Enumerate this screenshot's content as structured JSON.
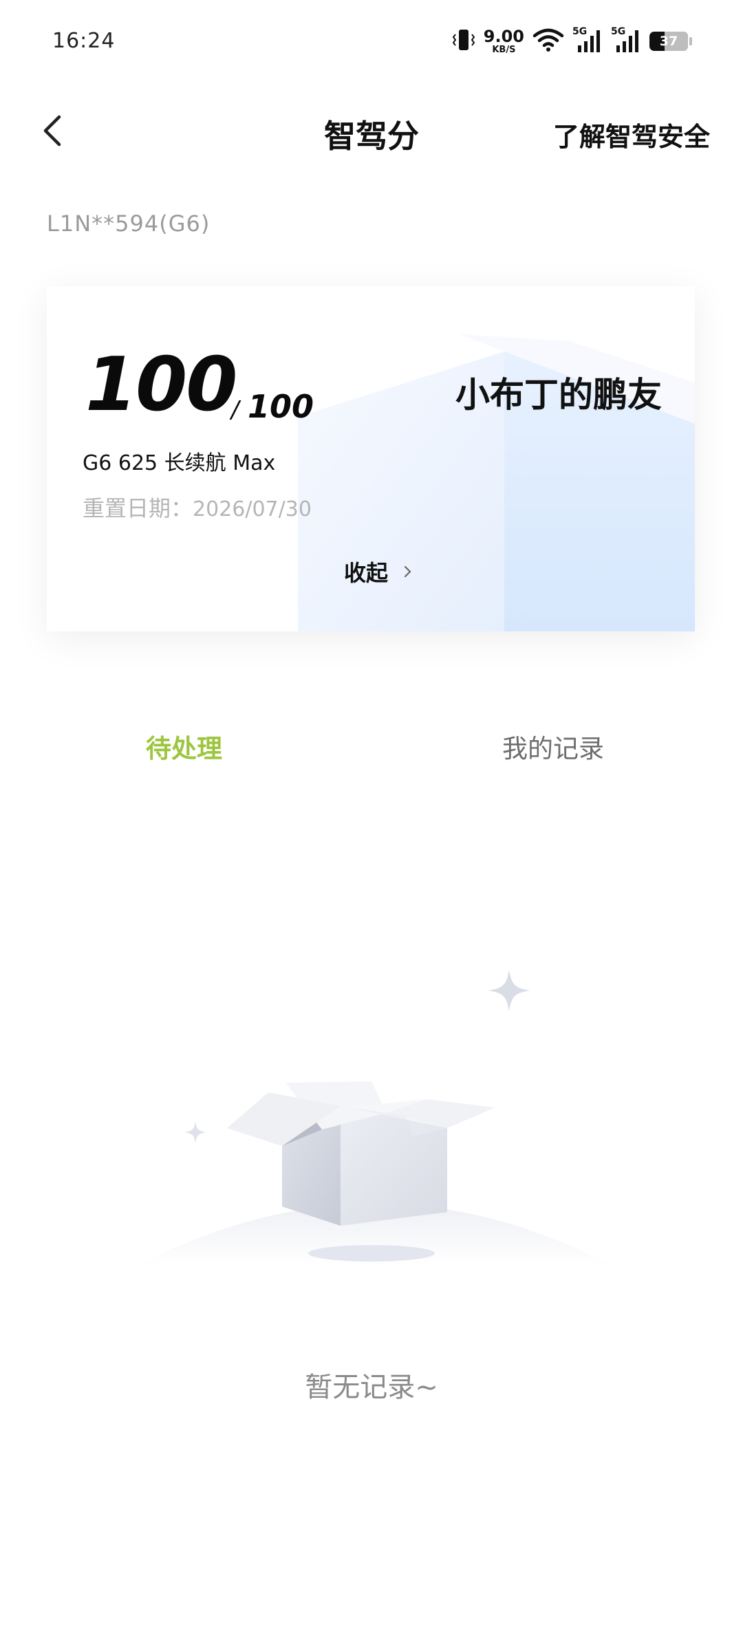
{
  "status_bar": {
    "time": "16:24",
    "net_speed_value": "9.00",
    "net_speed_unit": "KB/S",
    "signal_label_1": "5G",
    "signal_label_2": "5G",
    "battery": "37",
    "icons": [
      "vibrate-icon",
      "wifi-icon",
      "signal-icon",
      "signal-icon",
      "battery-icon"
    ]
  },
  "header": {
    "title": "智驾分",
    "right_link": "了解智驾安全",
    "back_icon": "chevron-left-icon"
  },
  "vehicle": {
    "plate": "L1N**594(G6)"
  },
  "score_card": {
    "score": "100",
    "separator": "/",
    "max_score": "100",
    "nickname": "小布丁的鹏友",
    "model": "G6 625 长续航 Max",
    "reset_label": "重置日期：",
    "reset_date": "2026/07/30",
    "collapse_label": "收起",
    "collapse_icon": "chevron-right-icon"
  },
  "tabs": {
    "pending": "待处理",
    "records": "我的记录",
    "active_color": "#9DC53F"
  },
  "empty_state": {
    "text": "暂无记录~",
    "illustration_icon": "empty-box-icon"
  }
}
